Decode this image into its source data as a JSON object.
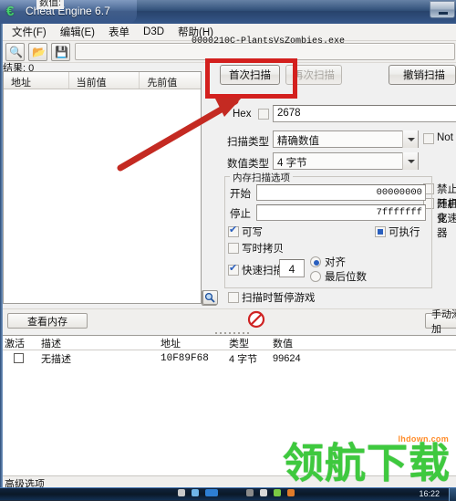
{
  "window": {
    "title": "Cheat Engine 6.7",
    "icon": "cheat-engine-logo-icon",
    "minimize_label": "",
    "process_title": "0000210C-PlantsVsZombies.exe"
  },
  "menubar": [
    {
      "label": "文件(F)",
      "name": "menu-file"
    },
    {
      "label": "编辑(E)",
      "name": "menu-edit"
    },
    {
      "label": "表单",
      "name": "menu-form"
    },
    {
      "label": "D3D",
      "name": "menu-d3d"
    },
    {
      "label": "帮助(H)",
      "name": "menu-help"
    }
  ],
  "toolbar": {
    "open_process_icon": "process-select-icon",
    "open_file_icon": "folder-open-icon",
    "save_file_icon": "save-disk-icon"
  },
  "results": {
    "label": "结果: 0",
    "columns": [
      "地址",
      "当前值",
      "先前值"
    ],
    "rows": []
  },
  "scan_buttons": {
    "first_scan": "首次扫描",
    "next_scan": "再次扫描",
    "undo_scan": "撤销扫描"
  },
  "value_group": {
    "legend": "数值:",
    "hex_label": "Hex",
    "hex_checked": false,
    "value": "2678"
  },
  "scan_type": {
    "label": "扫描类型",
    "selected": "精确数值"
  },
  "value_type": {
    "label": "数值类型",
    "selected": "4 字节"
  },
  "not_option": {
    "label": "Not",
    "checked": false
  },
  "memory_scan_options": {
    "legend": "内存扫描选项",
    "start_label": "开始",
    "start_value": "00000000",
    "stop_label": "停止",
    "stop_value": "7fffffff",
    "writable": {
      "label": "可写",
      "checked": true
    },
    "executable": {
      "label": "可执行",
      "checked": true
    },
    "copy_on_write": {
      "label": "写时拷贝",
      "checked": false
    },
    "fast_scan": {
      "label": "快速扫描",
      "checked": true,
      "value": "4"
    },
    "alignment": {
      "label": "对齐",
      "selected": true
    },
    "last_digits": {
      "label": "最后位数",
      "selected": false
    },
    "pause_game": {
      "label": "扫描时暂停游戏",
      "checked": false
    }
  },
  "side_options": {
    "no_randomize": {
      "label": "禁止随机化",
      "checked": false
    },
    "speedhack": {
      "label": "开启变速器",
      "checked": false
    }
  },
  "mid_bar": {
    "view_memory": "查看内存",
    "manual_add": "手动添加",
    "stop_icon": "stop-scan-icon",
    "magnifier_icon": "magnifier-icon",
    "cursor_icon": "red-cursor-icon"
  },
  "cheat_table": {
    "columns": [
      "激活",
      "描述",
      "地址",
      "类型",
      "数值"
    ],
    "rows": [
      {
        "active": false,
        "description": "无描述",
        "address": "10F89F68",
        "type": "4 字节",
        "value": "99624"
      }
    ]
  },
  "statusbar": {
    "text": "高级选项"
  },
  "annotations": {
    "highlight_target": "首次扫描",
    "highlight_color": "#d3201e",
    "arrow_color": "#c42a22"
  },
  "watermark": {
    "text": "领航下载",
    "url": "lhdown.com",
    "color": "#3ec93e"
  },
  "taskbar": {
    "clock": "16:22"
  }
}
